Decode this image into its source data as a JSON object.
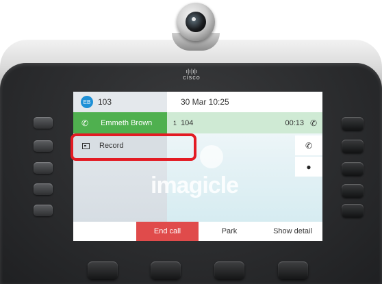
{
  "device": {
    "brand": "cisco"
  },
  "screen": {
    "header": {
      "avatar_initials": "EB",
      "line_extension": "103",
      "datetime": "30 Mar 10:25"
    },
    "active_call": {
      "contact_name": "Emmeth Brown",
      "line_number": "1",
      "extension": "104",
      "duration": "00:13"
    },
    "menu": {
      "record_label": "Record"
    },
    "watermark": "imagicle",
    "softkeys": {
      "end_call": "End call",
      "park": "Park",
      "show_detail": "Show detail"
    },
    "colors": {
      "call_active": "#4fb04f",
      "end_call": "#e04b4b",
      "avatar": "#1e90d6",
      "highlight": "#e31b23"
    }
  }
}
